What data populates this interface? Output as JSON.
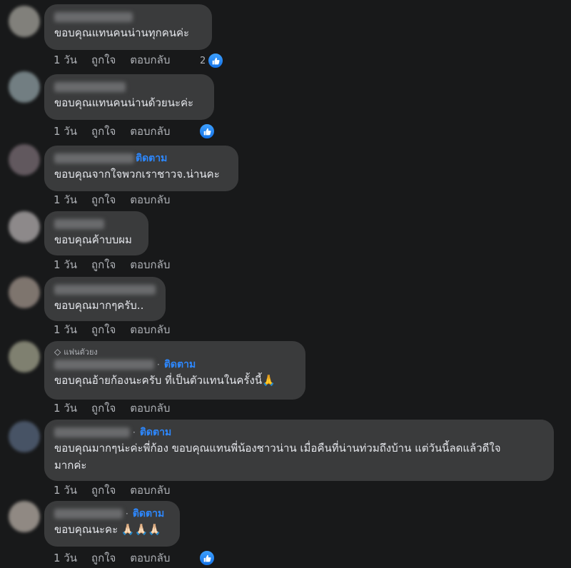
{
  "actions": {
    "time": "1 วัน",
    "like": "ถูกใจ",
    "reply": "ตอบกลับ"
  },
  "follow_label": "ติดตาม",
  "badge_label": "แฟนตัวยง",
  "comments": [
    {
      "text": "ขอบคุณแทนคนน่านทุกคนค่ะ",
      "reaction_count": "2"
    },
    {
      "text": "ขอบคุณแทนคนน่านด้วยนะค่ะ"
    },
    {
      "text": "ขอบคุณจากใจพวกเราชาวจ.น่านคะ"
    },
    {
      "text": "ขอบคุณค้าบบผม"
    },
    {
      "text": "ขอบคุณมากๆครับ.."
    },
    {
      "text": "ขอบคุณอ้ายก้องนะครับ ที่เป็นตัวแทนในครั้งนี้🙏"
    },
    {
      "text": "ขอบคุณมากๆน่ะค่ะพี่ก้อง ขอบคุณแทนพี่น้องชาวน่าน เมื่อคืนที่น่านท่วมถึงบ้าน แต่วันนี้ลดแล้วดีใจ",
      "text_line2": "มากค่ะ"
    },
    {
      "text": "ขอบคุณนะคะ 🙏🏻🙏🏻🙏🏻"
    }
  ],
  "colors": {
    "bubble": "#3a3b3c",
    "background": "#18191a",
    "follow": "#2d88ff",
    "like": "#1877f2"
  }
}
